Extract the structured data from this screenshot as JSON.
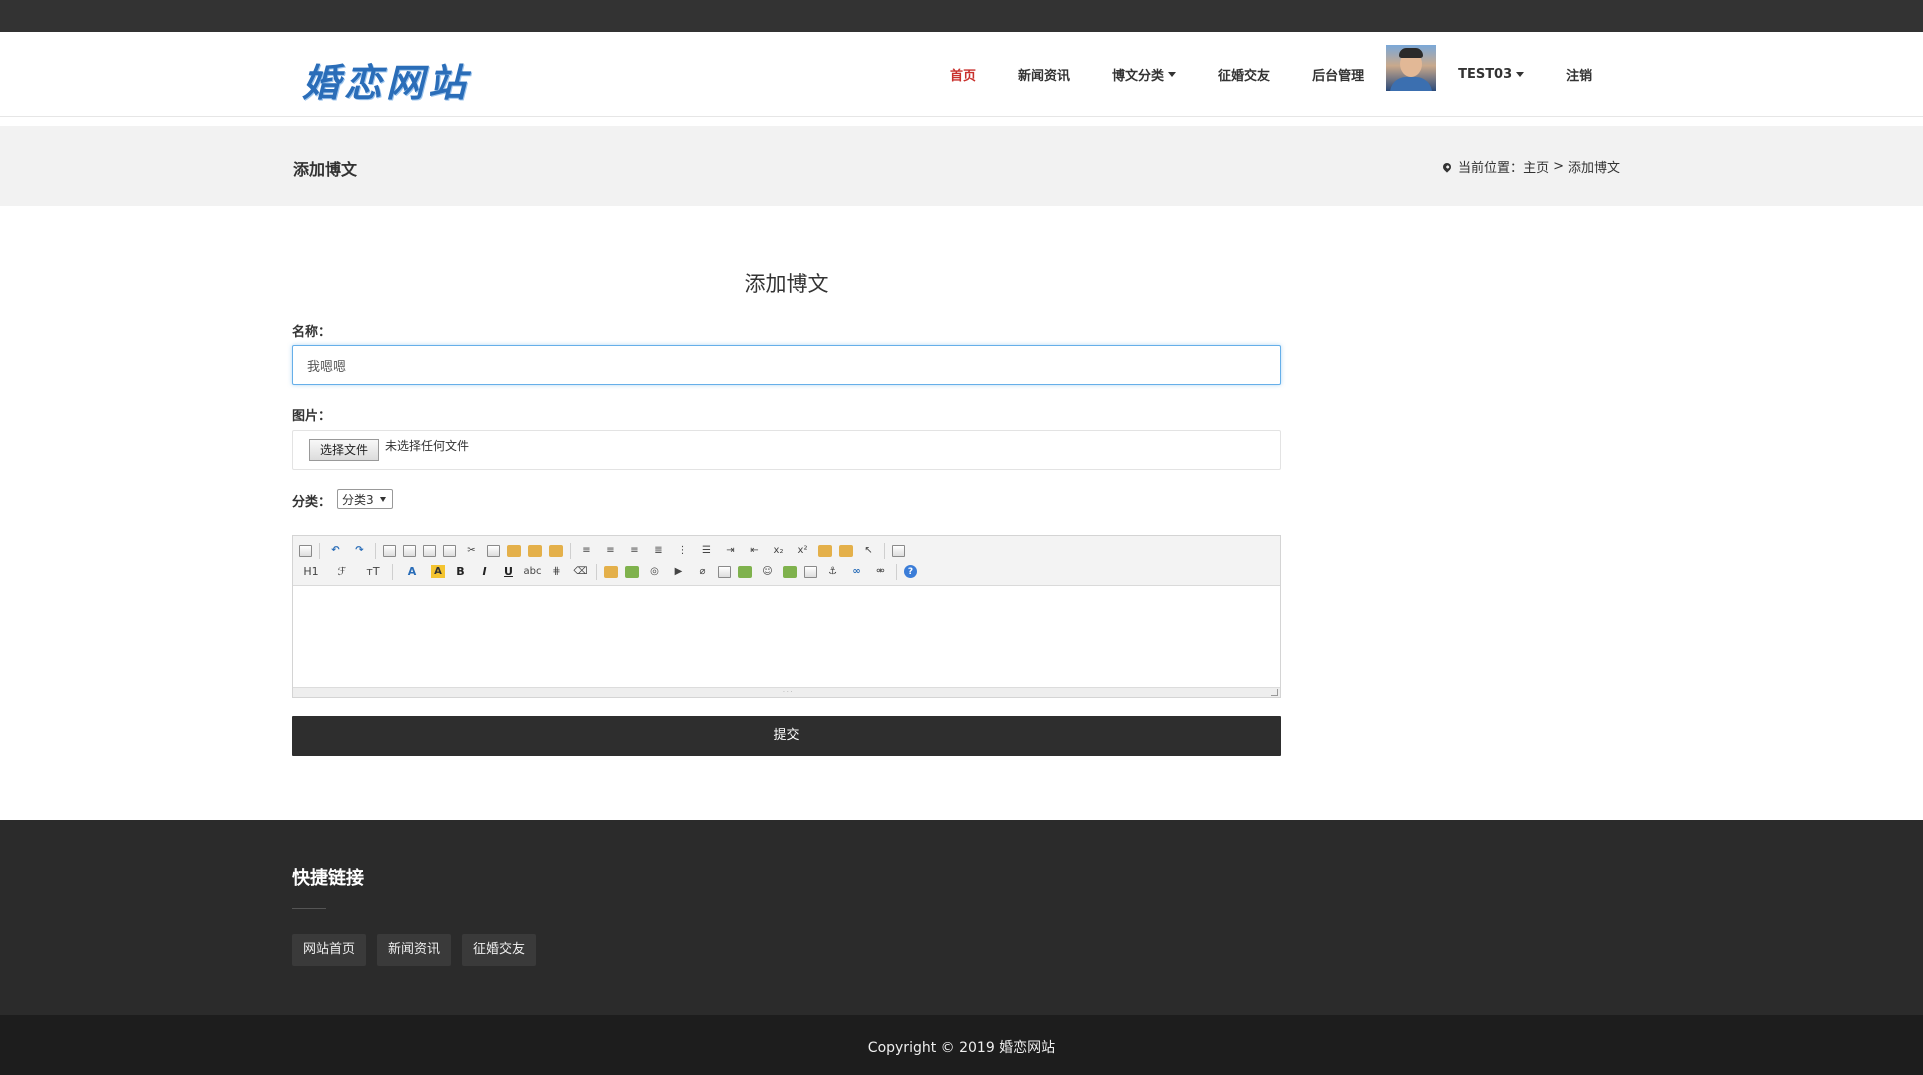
{
  "site": {
    "logo": "婚恋网站"
  },
  "nav": {
    "home": "首页",
    "news": "新闻资讯",
    "blog_categories": "博文分类",
    "dating": "征婚交友",
    "admin": "后台管理",
    "user": "TEST03",
    "logout": "注销"
  },
  "banner": {
    "title": "添加博文",
    "breadcrumb_prefix": "当前位置：",
    "breadcrumb_home": "主页",
    "breadcrumb_sep": ">",
    "breadcrumb_current": "添加博文"
  },
  "form": {
    "heading": "添加博文",
    "name_label": "名称：",
    "name_value": "我嗯嗯",
    "image_label": "图片：",
    "file_button": "选择文件",
    "file_status": "未选择任何文件",
    "category_label": "分类：",
    "category_value": "分类3",
    "submit": "提交"
  },
  "footer": {
    "title": "快捷链接",
    "links": [
      "网站首页",
      "新闻资讯",
      "征婚交友"
    ],
    "copyright": "Copyright © 2019 婚恋网站"
  }
}
